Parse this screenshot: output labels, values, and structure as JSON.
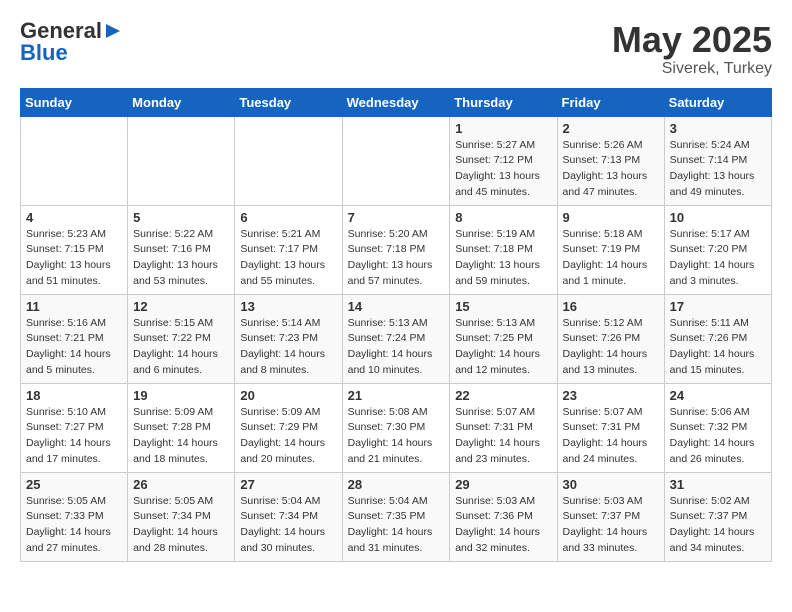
{
  "logo": {
    "general": "General",
    "blue": "Blue"
  },
  "header": {
    "month_year": "May 2025",
    "location": "Siverek, Turkey"
  },
  "weekdays": [
    "Sunday",
    "Monday",
    "Tuesday",
    "Wednesday",
    "Thursday",
    "Friday",
    "Saturday"
  ],
  "weeks": [
    [
      {
        "day": "",
        "info": ""
      },
      {
        "day": "",
        "info": ""
      },
      {
        "day": "",
        "info": ""
      },
      {
        "day": "",
        "info": ""
      },
      {
        "day": "1",
        "info": "Sunrise: 5:27 AM\nSunset: 7:12 PM\nDaylight: 13 hours\nand 45 minutes."
      },
      {
        "day": "2",
        "info": "Sunrise: 5:26 AM\nSunset: 7:13 PM\nDaylight: 13 hours\nand 47 minutes."
      },
      {
        "day": "3",
        "info": "Sunrise: 5:24 AM\nSunset: 7:14 PM\nDaylight: 13 hours\nand 49 minutes."
      }
    ],
    [
      {
        "day": "4",
        "info": "Sunrise: 5:23 AM\nSunset: 7:15 PM\nDaylight: 13 hours\nand 51 minutes."
      },
      {
        "day": "5",
        "info": "Sunrise: 5:22 AM\nSunset: 7:16 PM\nDaylight: 13 hours\nand 53 minutes."
      },
      {
        "day": "6",
        "info": "Sunrise: 5:21 AM\nSunset: 7:17 PM\nDaylight: 13 hours\nand 55 minutes."
      },
      {
        "day": "7",
        "info": "Sunrise: 5:20 AM\nSunset: 7:18 PM\nDaylight: 13 hours\nand 57 minutes."
      },
      {
        "day": "8",
        "info": "Sunrise: 5:19 AM\nSunset: 7:18 PM\nDaylight: 13 hours\nand 59 minutes."
      },
      {
        "day": "9",
        "info": "Sunrise: 5:18 AM\nSunset: 7:19 PM\nDaylight: 14 hours\nand 1 minute."
      },
      {
        "day": "10",
        "info": "Sunrise: 5:17 AM\nSunset: 7:20 PM\nDaylight: 14 hours\nand 3 minutes."
      }
    ],
    [
      {
        "day": "11",
        "info": "Sunrise: 5:16 AM\nSunset: 7:21 PM\nDaylight: 14 hours\nand 5 minutes."
      },
      {
        "day": "12",
        "info": "Sunrise: 5:15 AM\nSunset: 7:22 PM\nDaylight: 14 hours\nand 6 minutes."
      },
      {
        "day": "13",
        "info": "Sunrise: 5:14 AM\nSunset: 7:23 PM\nDaylight: 14 hours\nand 8 minutes."
      },
      {
        "day": "14",
        "info": "Sunrise: 5:13 AM\nSunset: 7:24 PM\nDaylight: 14 hours\nand 10 minutes."
      },
      {
        "day": "15",
        "info": "Sunrise: 5:13 AM\nSunset: 7:25 PM\nDaylight: 14 hours\nand 12 minutes."
      },
      {
        "day": "16",
        "info": "Sunrise: 5:12 AM\nSunset: 7:26 PM\nDaylight: 14 hours\nand 13 minutes."
      },
      {
        "day": "17",
        "info": "Sunrise: 5:11 AM\nSunset: 7:26 PM\nDaylight: 14 hours\nand 15 minutes."
      }
    ],
    [
      {
        "day": "18",
        "info": "Sunrise: 5:10 AM\nSunset: 7:27 PM\nDaylight: 14 hours\nand 17 minutes."
      },
      {
        "day": "19",
        "info": "Sunrise: 5:09 AM\nSunset: 7:28 PM\nDaylight: 14 hours\nand 18 minutes."
      },
      {
        "day": "20",
        "info": "Sunrise: 5:09 AM\nSunset: 7:29 PM\nDaylight: 14 hours\nand 20 minutes."
      },
      {
        "day": "21",
        "info": "Sunrise: 5:08 AM\nSunset: 7:30 PM\nDaylight: 14 hours\nand 21 minutes."
      },
      {
        "day": "22",
        "info": "Sunrise: 5:07 AM\nSunset: 7:31 PM\nDaylight: 14 hours\nand 23 minutes."
      },
      {
        "day": "23",
        "info": "Sunrise: 5:07 AM\nSunset: 7:31 PM\nDaylight: 14 hours\nand 24 minutes."
      },
      {
        "day": "24",
        "info": "Sunrise: 5:06 AM\nSunset: 7:32 PM\nDaylight: 14 hours\nand 26 minutes."
      }
    ],
    [
      {
        "day": "25",
        "info": "Sunrise: 5:05 AM\nSunset: 7:33 PM\nDaylight: 14 hours\nand 27 minutes."
      },
      {
        "day": "26",
        "info": "Sunrise: 5:05 AM\nSunset: 7:34 PM\nDaylight: 14 hours\nand 28 minutes."
      },
      {
        "day": "27",
        "info": "Sunrise: 5:04 AM\nSunset: 7:34 PM\nDaylight: 14 hours\nand 30 minutes."
      },
      {
        "day": "28",
        "info": "Sunrise: 5:04 AM\nSunset: 7:35 PM\nDaylight: 14 hours\nand 31 minutes."
      },
      {
        "day": "29",
        "info": "Sunrise: 5:03 AM\nSunset: 7:36 PM\nDaylight: 14 hours\nand 32 minutes."
      },
      {
        "day": "30",
        "info": "Sunrise: 5:03 AM\nSunset: 7:37 PM\nDaylight: 14 hours\nand 33 minutes."
      },
      {
        "day": "31",
        "info": "Sunrise: 5:02 AM\nSunset: 7:37 PM\nDaylight: 14 hours\nand 34 minutes."
      }
    ]
  ]
}
